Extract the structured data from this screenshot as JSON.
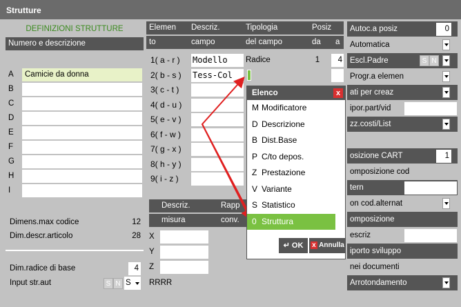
{
  "title": "Strutture",
  "left": {
    "header": "DEFINIZIONI STRUTTURE",
    "subheader": "Numero e descrizione",
    "rows": [
      {
        "letter": "A",
        "value": "Camicie da donna"
      },
      {
        "letter": "B",
        "value": ""
      },
      {
        "letter": "C",
        "value": ""
      },
      {
        "letter": "D",
        "value": ""
      },
      {
        "letter": "E",
        "value": ""
      },
      {
        "letter": "F",
        "value": ""
      },
      {
        "letter": "G",
        "value": ""
      },
      {
        "letter": "H",
        "value": ""
      },
      {
        "letter": "I",
        "value": ""
      }
    ],
    "dimens_label": "Dimens.max codice",
    "dimens_value": "12",
    "dimdescr_label": "Dim.descr.articolo",
    "dimdescr_value": "28",
    "radice_label": "Dim.radice di base",
    "radice_value": "4",
    "input_label": "Input str.aut",
    "input_s": "S",
    "input_n": "N",
    "input_value": "S"
  },
  "middle": {
    "headers1": [
      "Elemen",
      "Descriz.",
      "Tipologia",
      "Posiz"
    ],
    "headers2": [
      "to",
      "campo",
      "del campo",
      "da",
      "a"
    ],
    "rows": [
      {
        "el": "1( a - r )",
        "desc": "Modello",
        "tip": "Radice",
        "da": "1",
        "a": "4"
      },
      {
        "el": "2( b - s )",
        "desc": "Tess-Col",
        "tip": "",
        "da": "",
        "a": ""
      },
      {
        "el": "3( c - t )"
      },
      {
        "el": "4( d - u )"
      },
      {
        "el": "5( e - v )"
      },
      {
        "el": "6( f - w )"
      },
      {
        "el": "7( g - x )"
      },
      {
        "el": "8( h - y )"
      },
      {
        "el": "9( i - z )"
      }
    ],
    "sub_h1": [
      "Descriz.",
      "Rapp"
    ],
    "sub_h2": [
      "misura",
      "conv."
    ],
    "xyz": [
      "X",
      "Y",
      "Z"
    ],
    "footer": "RRRR"
  },
  "right": {
    "rows": [
      {
        "label": "Autoc.a posiz",
        "value": "0"
      },
      {
        "label": "Automatica"
      },
      {
        "label": "Escl.Padre",
        "s": "S",
        "n": "N"
      },
      {
        "label": "Progr.a elemen"
      },
      {
        "label": "ati per creaz"
      },
      {
        "label": "ipor.part/vid"
      },
      {
        "label": "zz.costi/List"
      },
      {
        "label": ""
      },
      {
        "label": "osizione CART",
        "value": "1"
      },
      {
        "label": "omposizione cod"
      },
      {
        "label": "tern"
      },
      {
        "label": "on cod.alternat"
      },
      {
        "label": "omposizione"
      },
      {
        "label": "escriz"
      },
      {
        "label": "iporto sviluppo"
      },
      {
        "label": "nei documenti"
      },
      {
        "label": "Arrotondamento"
      }
    ]
  },
  "popup": {
    "title": "Elenco",
    "close": "x",
    "items": [
      {
        "code": "M",
        "label": "Modificatore"
      },
      {
        "code": "D",
        "label": "Descrizione"
      },
      {
        "code": "B",
        "label": "Dist.Base"
      },
      {
        "code": "P",
        "label": "C/to depos."
      },
      {
        "code": "Z",
        "label": "Prestazione"
      },
      {
        "code": "V",
        "label": "Variante"
      },
      {
        "code": "S",
        "label": "Statistico"
      },
      {
        "code": "0",
        "label": "Struttura"
      }
    ],
    "ok": "OK",
    "cancel": "Annulla"
  },
  "colors": {
    "green": "#7ac142",
    "red": "#e02020",
    "dark": "#555555"
  }
}
